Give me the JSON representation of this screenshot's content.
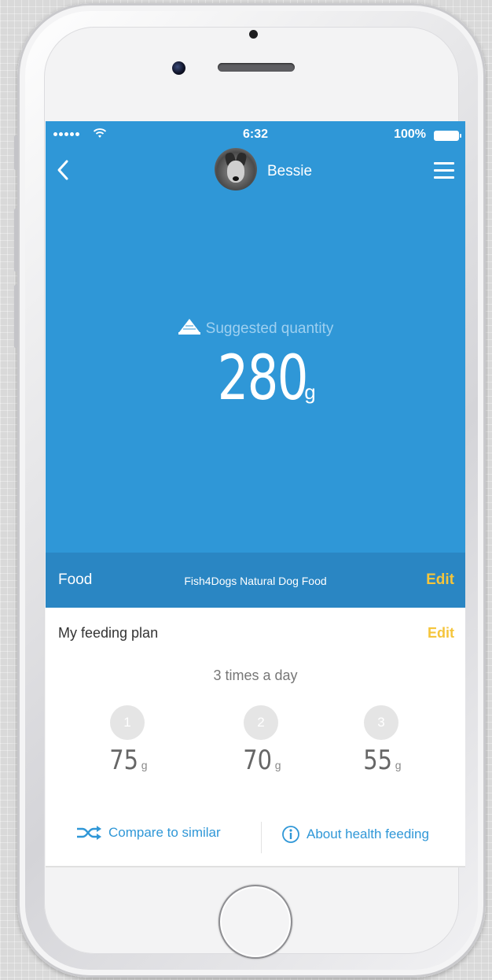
{
  "status_bar": {
    "time": "6:32",
    "battery": "100%"
  },
  "header": {
    "pet_name": "Bessie"
  },
  "hero": {
    "suggested_label": "Suggested quantity",
    "quantity": "280",
    "unit": "g"
  },
  "food": {
    "label": "Food",
    "name": "Fish4Dogs Natural Dog Food",
    "edit": "Edit"
  },
  "plan": {
    "title": "My feeding plan",
    "edit": "Edit",
    "frequency": "3 times a day",
    "meals": [
      {
        "index": "1",
        "amount": "75",
        "unit": "g"
      },
      {
        "index": "2",
        "amount": "70",
        "unit": "g"
      },
      {
        "index": "3",
        "amount": "55",
        "unit": "g"
      }
    ]
  },
  "actions": {
    "compare": "Compare to similar",
    "about": "About health feeding"
  },
  "icons": [
    "back-icon",
    "menu-icon",
    "wifi-icon",
    "battery-icon",
    "food-pyramid-icon",
    "shuffle-icon",
    "info-icon"
  ],
  "colors": {
    "primary": "#2f97d7",
    "food_bar": "#2a86c3",
    "accent": "#f5c53b"
  }
}
